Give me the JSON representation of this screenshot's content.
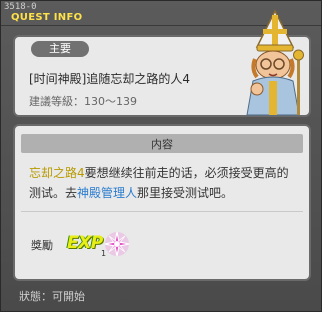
{
  "window": {
    "id_text": "3518-0",
    "title": "QUEST INFO"
  },
  "quest": {
    "badge": "主要",
    "title": "[时间神殿]追随忘却之路的人4",
    "level": "建議等級：130～139"
  },
  "content": {
    "header": "内容",
    "desc_part1": "忘却之路4",
    "desc_part2": "要想继续往前走的话，必须接受更高的测试。去",
    "desc_part3": "神殿管理人",
    "desc_part4": "那里接受测试吧。"
  },
  "reward": {
    "label": "獎勵",
    "exp_label": "EXP",
    "count": "1",
    "item_icon": "pink-star-icon"
  },
  "status": {
    "text": "狀態：可開始"
  },
  "colors": {
    "accent": "#ffe14a",
    "highlight": "#b89a00",
    "link": "#2a7ccf"
  }
}
